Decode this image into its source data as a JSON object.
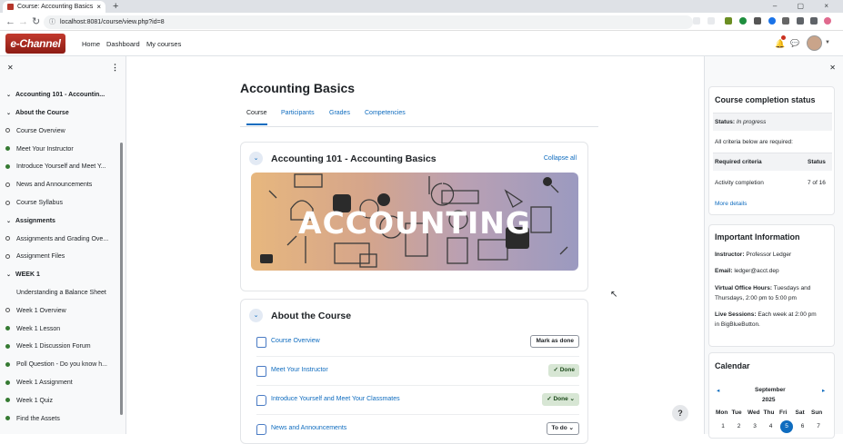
{
  "browser": {
    "tab_title": "Course: Accounting Basics",
    "url": "localhost:8081/course/view.php?id=8"
  },
  "site_nav": {
    "logo_text": "e-Channel",
    "links": [
      "Home",
      "Dashboard",
      "My courses"
    ],
    "notification_count": "1"
  },
  "course_index": {
    "title": "Accounting 101 - Accountin...",
    "entries": [
      {
        "type": "section",
        "label": "About the Course",
        "status": ""
      },
      {
        "type": "item",
        "label": "Course Overview",
        "status": "incomplete"
      },
      {
        "type": "item",
        "label": "Meet Your Instructor",
        "status": "complete"
      },
      {
        "type": "item",
        "label": "Introduce Yourself and Meet Y...",
        "status": "complete"
      },
      {
        "type": "item",
        "label": "News and Announcements",
        "status": "incomplete"
      },
      {
        "type": "item",
        "label": "Course Syllabus",
        "status": "incomplete"
      },
      {
        "type": "section",
        "label": "Assignments",
        "status": ""
      },
      {
        "type": "item",
        "label": "Assignments and Grading Ove...",
        "status": "incomplete"
      },
      {
        "type": "item",
        "label": "Assignment Files",
        "status": "incomplete"
      },
      {
        "type": "section",
        "label": "WEEK 1",
        "status": ""
      },
      {
        "type": "item",
        "label": "Understanding a Balance Sheet",
        "status": "none"
      },
      {
        "type": "item",
        "label": "Week 1 Overview",
        "status": "incomplete"
      },
      {
        "type": "item",
        "label": "Week 1 Lesson",
        "status": "complete"
      },
      {
        "type": "item",
        "label": "Week 1 Discussion Forum",
        "status": "complete"
      },
      {
        "type": "item",
        "label": "Poll Question - Do you know h...",
        "status": "complete"
      },
      {
        "type": "item",
        "label": "Week 1 Assignment",
        "status": "complete"
      },
      {
        "type": "item",
        "label": "Week 1 Quiz",
        "status": "complete"
      },
      {
        "type": "item",
        "label": "Find the Assets",
        "status": "complete"
      }
    ]
  },
  "main": {
    "page_title": "Accounting Basics",
    "tabs": [
      "Course",
      "Participants",
      "Grades",
      "Competencies"
    ],
    "section1": {
      "title": "Accounting 101 - Accounting Basics",
      "collapse_label": "Collapse all",
      "banner_text": "ACCOUNTING"
    },
    "section2": {
      "title": "About the Course",
      "activities": [
        {
          "label": "Course Overview",
          "button": "Mark as done",
          "icon": "page-icon"
        },
        {
          "label": "Meet Your Instructor",
          "button": "✓ Done",
          "icon": "page-icon"
        },
        {
          "label": "Introduce Yourself and Meet Your Classmates",
          "button": "✓ Done ⌄",
          "icon": "forum-icon"
        },
        {
          "label": "News and Announcements",
          "button": "To do ⌄",
          "icon": "forum-icon"
        }
      ]
    },
    "help_label": "?"
  },
  "right_drawer": {
    "completion": {
      "title": "Course completion status",
      "status_label": "Status:",
      "status_value": "In progress",
      "criteria_note": "All criteria below are required:",
      "col_criteria": "Required criteria",
      "col_status": "Status",
      "row_label": "Activity completion",
      "row_value": "7 of 16",
      "more_details": "More details"
    },
    "info": {
      "title": "Important Information",
      "instructor_label": "Instructor:",
      "instructor_value": "Professor Ledger",
      "email_label": "Email:",
      "email_value": "ledger@acct.dep",
      "hours_label": "Virtual Office Hours:",
      "hours_value1": "Tuesdays and",
      "hours_value2": "Thursdays, 2:00 pm to 5:00 pm",
      "live_label": "Live Sessions:",
      "live_value1": "Each week at 2:00 pm",
      "live_value2": "in BigBlueButton."
    },
    "calendar": {
      "title": "Calendar",
      "month": "September",
      "year": "2025",
      "weekdays": [
        "Mon",
        "Tue",
        "Wed",
        "Thu",
        "Fri",
        "Sat",
        "Sun"
      ],
      "days": [
        "1",
        "2",
        "3",
        "4",
        "5",
        "6",
        "7"
      ],
      "today": "5"
    }
  }
}
